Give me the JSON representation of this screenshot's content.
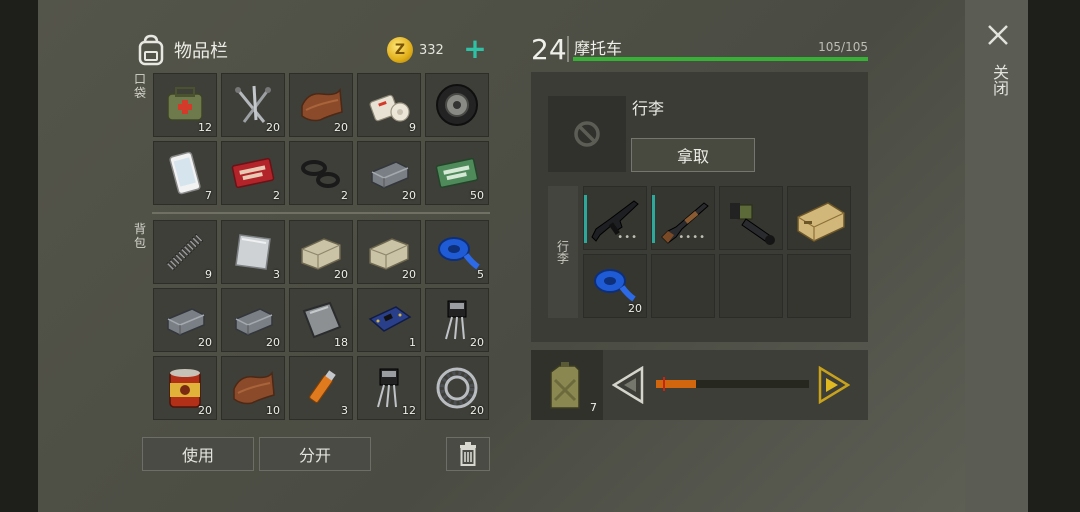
{
  "inventory": {
    "title": "物品栏",
    "coins": "332",
    "pockets_label": "口袋",
    "backpack_label": "背包",
    "pockets": [
      {
        "icon": "medkit-bag-icon",
        "count": "12"
      },
      {
        "icon": "nails-icon",
        "count": "20"
      },
      {
        "icon": "leather-icon",
        "count": "20"
      },
      {
        "icon": "bandage-icon",
        "count": "9"
      },
      {
        "icon": "tire-icon",
        "count": ""
      },
      {
        "icon": "smartphone-icon",
        "count": "7"
      },
      {
        "icon": "combat-coupon-icon",
        "count": "2"
      },
      {
        "icon": "rubber-rings-icon",
        "count": "2"
      },
      {
        "icon": "metal-bar-icon",
        "count": "20"
      },
      {
        "icon": "ration-coupon-icon",
        "count": "50"
      }
    ],
    "backpack": [
      {
        "icon": "spring-icon",
        "count": "9"
      },
      {
        "icon": "metal-sheet-icon",
        "count": "3"
      },
      {
        "icon": "stone-icon",
        "count": "20"
      },
      {
        "icon": "stone-icon",
        "count": "20"
      },
      {
        "icon": "tape-icon",
        "count": "5"
      },
      {
        "icon": "metal-bar-icon",
        "count": "20"
      },
      {
        "icon": "metal-bar-icon",
        "count": "20"
      },
      {
        "icon": "metal-plate-icon",
        "count": "18"
      },
      {
        "icon": "circuit-board-icon",
        "count": "1"
      },
      {
        "icon": "transistor-icon",
        "count": "20"
      },
      {
        "icon": "canned-food-icon",
        "count": "20"
      },
      {
        "icon": "leather-icon",
        "count": "10"
      },
      {
        "icon": "usb-drive-icon",
        "count": "3"
      },
      {
        "icon": "transistor-icon",
        "count": "12"
      },
      {
        "icon": "bearing-icon",
        "count": "20"
      }
    ],
    "use_label": "使用",
    "split_label": "分开"
  },
  "vehicle": {
    "level": "24",
    "name": "摩托车",
    "hp": "105/105",
    "hp_fraction": 1.0,
    "luggage_title": "行李",
    "take_label": "拿取",
    "luggage_side_label": "行李",
    "luggage": [
      {
        "icon": "assault-rifle-icon",
        "count": "",
        "dots": "•••",
        "tag": true
      },
      {
        "icon": "shotgun-icon",
        "count": "",
        "dots": "••••",
        "tag": true
      },
      {
        "icon": "grenade-launcher-icon",
        "count": "",
        "dots": "",
        "tag": false
      },
      {
        "icon": "ammo-box-icon",
        "count": "",
        "dots": "",
        "tag": false
      },
      {
        "icon": "tape-icon",
        "count": "20",
        "dots": "",
        "tag": false
      },
      {
        "icon": "",
        "count": "",
        "dots": "",
        "tag": false
      },
      {
        "icon": "",
        "count": "",
        "dots": "",
        "tag": false
      },
      {
        "icon": "",
        "count": "",
        "dots": "",
        "tag": false
      }
    ],
    "fuel": {
      "count": "7",
      "level": 0.26
    }
  },
  "close_label": "关闭",
  "colors": {
    "accent": "#2fc1a5",
    "hp": "#36b035",
    "fuel": "#d2660e",
    "arrow": "#c8a21c"
  }
}
